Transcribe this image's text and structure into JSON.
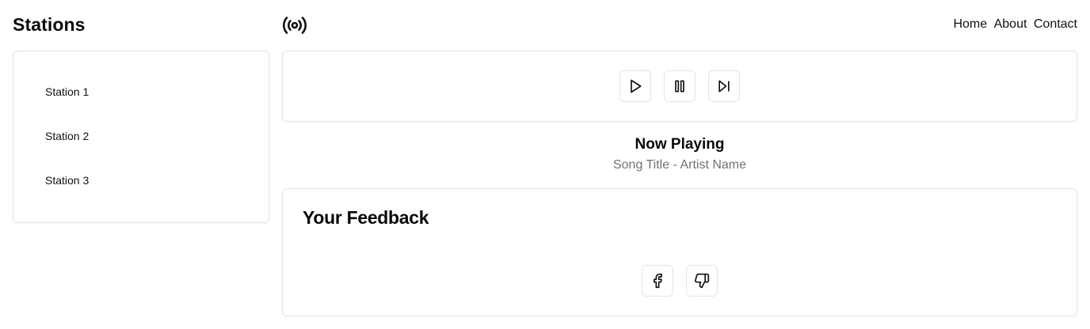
{
  "sidebar": {
    "title": "Stations",
    "stations": [
      {
        "label": "Station 1"
      },
      {
        "label": "Station 2"
      },
      {
        "label": "Station 3"
      }
    ]
  },
  "header": {
    "logo_icon": "radio-broadcast-icon",
    "nav": [
      {
        "label": "Home"
      },
      {
        "label": "About"
      },
      {
        "label": "Contact"
      }
    ]
  },
  "player": {
    "controls": [
      {
        "icon": "play-icon"
      },
      {
        "icon": "pause-icon"
      },
      {
        "icon": "skip-forward-icon"
      }
    ],
    "now_playing_label": "Now Playing",
    "track": "Song Title - Artist Name"
  },
  "feedback": {
    "title": "Your Feedback",
    "buttons": [
      {
        "icon": "facebook-icon"
      },
      {
        "icon": "thumbs-down-icon"
      }
    ]
  },
  "colors": {
    "border": "#e4e4e7",
    "muted_text": "#71717a",
    "text": "#0a0a0a"
  }
}
